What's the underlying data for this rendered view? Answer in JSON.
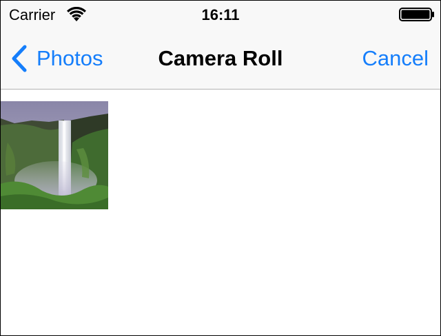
{
  "status_bar": {
    "carrier": "Carrier",
    "time": "16:11",
    "wifi_icon": "wifi-icon",
    "battery_icon": "battery-icon"
  },
  "nav_bar": {
    "back_label": "Photos",
    "back_icon": "chevron-left-icon",
    "title": "Camera Roll",
    "cancel_label": "Cancel"
  },
  "colors": {
    "accent": "#157efb",
    "bar_background": "#f8f8f8",
    "separator": "#b2b2b2"
  },
  "photos": [
    {
      "subject": "waterfall-photo"
    }
  ]
}
